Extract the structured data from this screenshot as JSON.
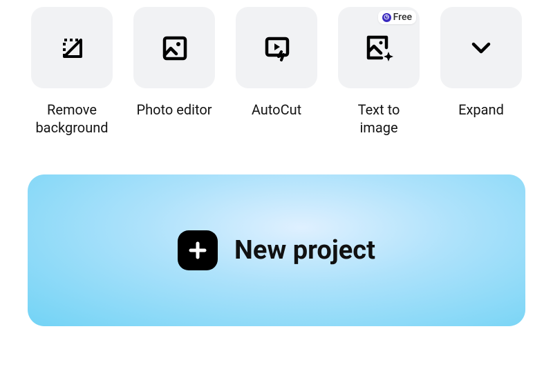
{
  "toolbar": {
    "items": [
      {
        "label": "Remove background"
      },
      {
        "label": "Photo editor"
      },
      {
        "label": "AutoCut"
      },
      {
        "label": "Text to image",
        "badge": "Free"
      },
      {
        "label": "Expand"
      }
    ]
  },
  "main": {
    "new_project_label": "New project"
  }
}
